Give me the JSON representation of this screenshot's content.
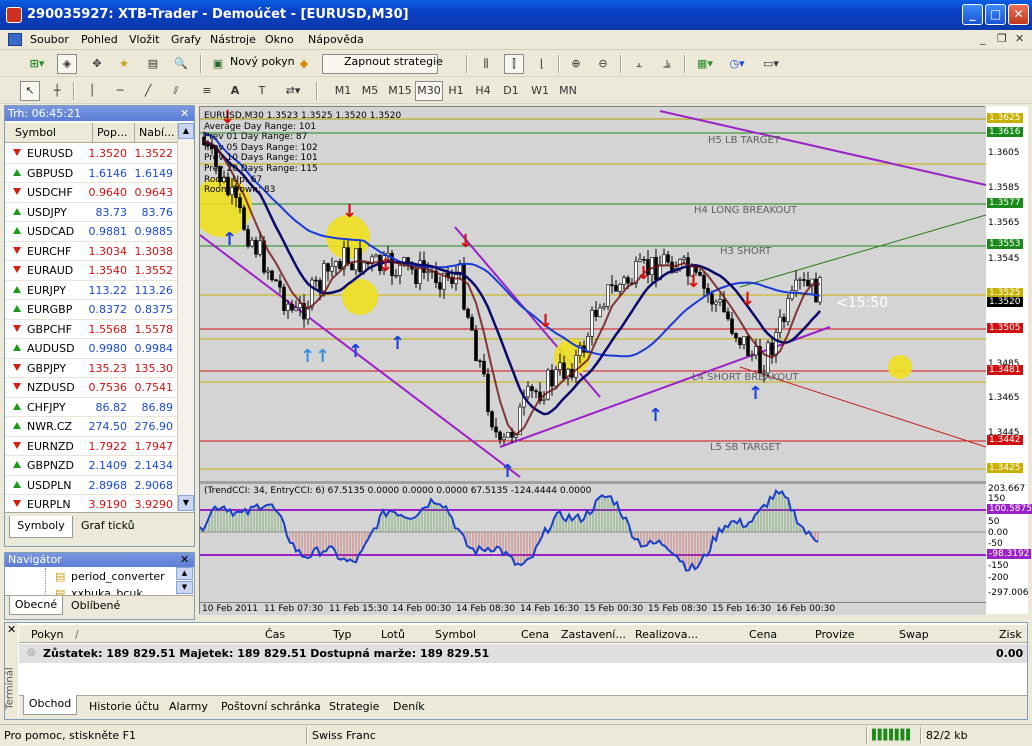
{
  "window": {
    "title": "290035927: XTB-Trader - Demoúčet - [EURUSD,M30]",
    "minimize": "_",
    "maximize": "□",
    "close": "✕"
  },
  "menu": [
    "Soubor",
    "Pohled",
    "Vložit",
    "Grafy",
    "Nástroje",
    "Okno",
    "Nápověda"
  ],
  "toolbar": {
    "new_order": "Nový pokyn",
    "strategy": "Zapnout strategie"
  },
  "timeframes": [
    "M1",
    "M5",
    "M15",
    "M30",
    "H1",
    "H4",
    "D1",
    "W1",
    "MN"
  ],
  "market_watch": {
    "title": "Trh: 06:45:21",
    "col_symbol": "Symbol",
    "col_bid": "Pop...",
    "col_ask": "Nabí...",
    "rows": [
      {
        "dir": "dn",
        "symbol": "EURUSD",
        "bid": "1.3520",
        "ask": "1.3522"
      },
      {
        "dir": "up",
        "symbol": "GBPUSD",
        "bid": "1.6146",
        "ask": "1.6149"
      },
      {
        "dir": "dn",
        "symbol": "USDCHF",
        "bid": "0.9640",
        "ask": "0.9643"
      },
      {
        "dir": "up",
        "symbol": "USDJPY",
        "bid": "83.73",
        "ask": "83.76"
      },
      {
        "dir": "up",
        "symbol": "USDCAD",
        "bid": "0.9881",
        "ask": "0.9885"
      },
      {
        "dir": "dn",
        "symbol": "EURCHF",
        "bid": "1.3034",
        "ask": "1.3038"
      },
      {
        "dir": "dn",
        "symbol": "EURAUD",
        "bid": "1.3540",
        "ask": "1.3552"
      },
      {
        "dir": "up",
        "symbol": "EURJPY",
        "bid": "113.22",
        "ask": "113.26"
      },
      {
        "dir": "up",
        "symbol": "EURGBP",
        "bid": "0.8372",
        "ask": "0.8375"
      },
      {
        "dir": "dn",
        "symbol": "GBPCHF",
        "bid": "1.5568",
        "ask": "1.5578"
      },
      {
        "dir": "up",
        "symbol": "AUDUSD",
        "bid": "0.9980",
        "ask": "0.9984"
      },
      {
        "dir": "dn",
        "symbol": "GBPJPY",
        "bid": "135.23",
        "ask": "135.30"
      },
      {
        "dir": "dn",
        "symbol": "NZDUSD",
        "bid": "0.7536",
        "ask": "0.7541"
      },
      {
        "dir": "up",
        "symbol": "CHFJPY",
        "bid": "86.82",
        "ask": "86.89"
      },
      {
        "dir": "up",
        "symbol": "NWR.CZ",
        "bid": "274.50",
        "ask": "276.90"
      },
      {
        "dir": "dn",
        "symbol": "EURNZD",
        "bid": "1.7922",
        "ask": "1.7947"
      },
      {
        "dir": "up",
        "symbol": "GBPNZD",
        "bid": "2.1409",
        "ask": "2.1434"
      },
      {
        "dir": "up",
        "symbol": "USDPLN",
        "bid": "2.8968",
        "ask": "2.9068"
      },
      {
        "dir": "dn",
        "symbol": "EURPLN",
        "bid": "3.9190",
        "ask": "3.9290"
      }
    ],
    "tabs": [
      "Symboly",
      "Graf ticků"
    ]
  },
  "navigator": {
    "title": "Navigátor",
    "items": [
      "period_converter",
      "xxbuka_bcuk"
    ],
    "tabs": [
      "Obecné",
      "Oblíbené"
    ]
  },
  "chart": {
    "header": "EURUSD,M30  1.3523 1.3525 1.3520 1.3520",
    "info": [
      "Average Day  Range: 101",
      "Prev 01  Day  Range: 87",
      "Prev 05  Days Range: 102",
      "Prev 10  Days Range: 101",
      "Prev 20  Days Range: 115",
      "Room Up: 67",
      "Room Down: 83"
    ],
    "levels": [
      {
        "text": "H5 LB TARGET"
      },
      {
        "text": "H4 LONG BREAKOUT"
      },
      {
        "text": "H3 SHORT"
      },
      {
        "text": "L4 SHORT BREAKOUT"
      },
      {
        "text": "L5 SB TARGET"
      }
    ],
    "countdown": "<15:50",
    "price_labels": [
      "1.3625",
      "1.3616",
      "1.3605",
      "1.3585",
      "1.3577",
      "1.3565",
      "1.3553",
      "1.3545",
      "1.3525",
      "1.3520",
      "1.3505",
      "1.3485",
      "1.3481",
      "1.3465",
      "1.3445",
      "1.3442",
      "1.3425"
    ],
    "cci_header": "(TrendCCI: 34, EntryCCI: 6)  67.5135  0.0000  0.0000  0.0000  67.5135  -124.4444  0.0000",
    "cci_labels": [
      "203.667",
      "150",
      "100.5875",
      "50",
      "0.00",
      "-50",
      "-98.3192",
      "-150",
      "-200",
      "-297.006"
    ],
    "time_labels": [
      "10 Feb 2011",
      "11 Feb 07:30",
      "11 Feb 15:30",
      "14 Feb 00:30",
      "14 Feb 08:30",
      "14 Feb 16:30",
      "15 Feb 00:30",
      "15 Feb 08:30",
      "15 Feb 16:30",
      "16 Feb 00:30"
    ],
    "colors": {
      "bg": "#d4d4d4",
      "up_candle": "#2e8b3a",
      "down_candle": "#8b1a1a",
      "ma_fast": "#0a0a6a",
      "ma_slow": "#1a3ad6",
      "channel": "#9a20c8"
    }
  },
  "terminal": {
    "columns": [
      "Pokyn",
      "/",
      "Čas",
      "Typ",
      "Lotů",
      "Symbol",
      "Cena",
      "Zastavení...",
      "Realizova...",
      "Cena",
      "Provize",
      "Swap",
      "Zisk"
    ],
    "balance_line": "Zůstatek: 189 829.51  Majetek: 189 829.51  Dostupná marže: 189 829.51",
    "profit": "0.00",
    "side_label": "Terminál",
    "tabs": [
      "Obchod",
      "Historie účtu",
      "Alarmy",
      "Poštovní schránka",
      "Strategie",
      "Deník"
    ]
  },
  "status": {
    "help": "Pro pomoc, stiskněte F1",
    "profile": "Swiss Franc",
    "traffic": "82/2 kb"
  }
}
